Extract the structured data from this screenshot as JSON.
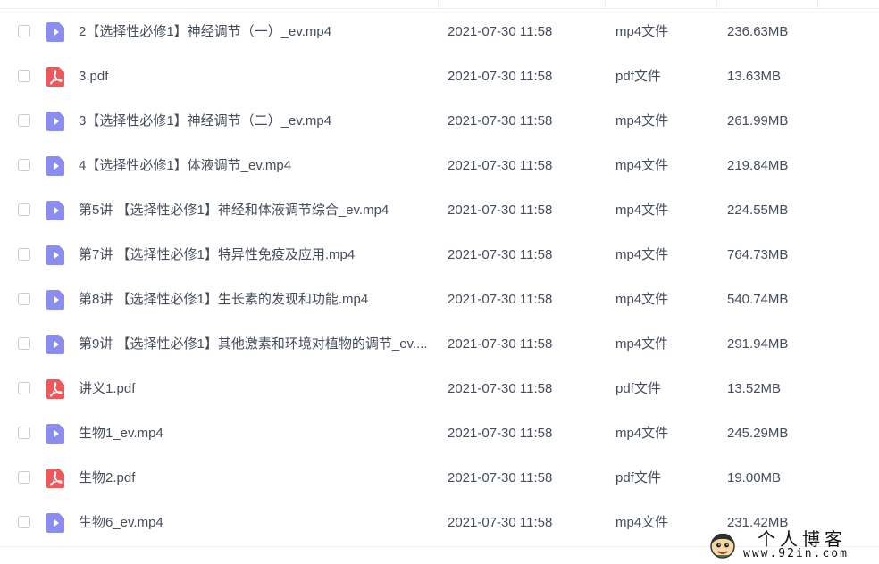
{
  "colors": {
    "video_icon": "#8b8ef0",
    "pdf_icon": "#f0575a",
    "text": "#454d5a",
    "border": "#eceef2"
  },
  "files": [
    {
      "name": "2【选择性必修1】神经调节（一）_ev.mp4",
      "date": "2021-07-30 11:58",
      "type": "mp4文件",
      "size": "236.63MB",
      "icon": "video-file-icon"
    },
    {
      "name": "3.pdf",
      "date": "2021-07-30 11:58",
      "type": "pdf文件",
      "size": "13.63MB",
      "icon": "pdf-file-icon"
    },
    {
      "name": "3【选择性必修1】神经调节（二）_ev.mp4",
      "date": "2021-07-30 11:58",
      "type": "mp4文件",
      "size": "261.99MB",
      "icon": "video-file-icon"
    },
    {
      "name": "4【选择性必修1】体液调节_ev.mp4",
      "date": "2021-07-30 11:58",
      "type": "mp4文件",
      "size": "219.84MB",
      "icon": "video-file-icon"
    },
    {
      "name": "第5讲 【选择性必修1】神经和体液调节综合_ev.mp4",
      "date": "2021-07-30 11:58",
      "type": "mp4文件",
      "size": "224.55MB",
      "icon": "video-file-icon"
    },
    {
      "name": "第7讲 【选择性必修1】特异性免疫及应用.mp4",
      "date": "2021-07-30 11:58",
      "type": "mp4文件",
      "size": "764.73MB",
      "icon": "video-file-icon"
    },
    {
      "name": "第8讲 【选择性必修1】生长素的发现和功能.mp4",
      "date": "2021-07-30 11:58",
      "type": "mp4文件",
      "size": "540.74MB",
      "icon": "video-file-icon"
    },
    {
      "name": "第9讲 【选择性必修1】其他激素和环境对植物的调节_ev....",
      "date": "2021-07-30 11:58",
      "type": "mp4文件",
      "size": "291.94MB",
      "icon": "video-file-icon"
    },
    {
      "name": "讲义1.pdf",
      "date": "2021-07-30 11:58",
      "type": "pdf文件",
      "size": "13.52MB",
      "icon": "pdf-file-icon"
    },
    {
      "name": "生物1_ev.mp4",
      "date": "2021-07-30 11:58",
      "type": "mp4文件",
      "size": "245.29MB",
      "icon": "video-file-icon"
    },
    {
      "name": "生物2.pdf",
      "date": "2021-07-30 11:58",
      "type": "pdf文件",
      "size": "19.00MB",
      "icon": "pdf-file-icon"
    },
    {
      "name": "生物6_ev.mp4",
      "date": "2021-07-30 11:58",
      "type": "mp4文件",
      "size": "231.42MB",
      "icon": "video-file-icon"
    }
  ],
  "watermark": {
    "title": "个人博客",
    "url": "www.92in.com"
  }
}
